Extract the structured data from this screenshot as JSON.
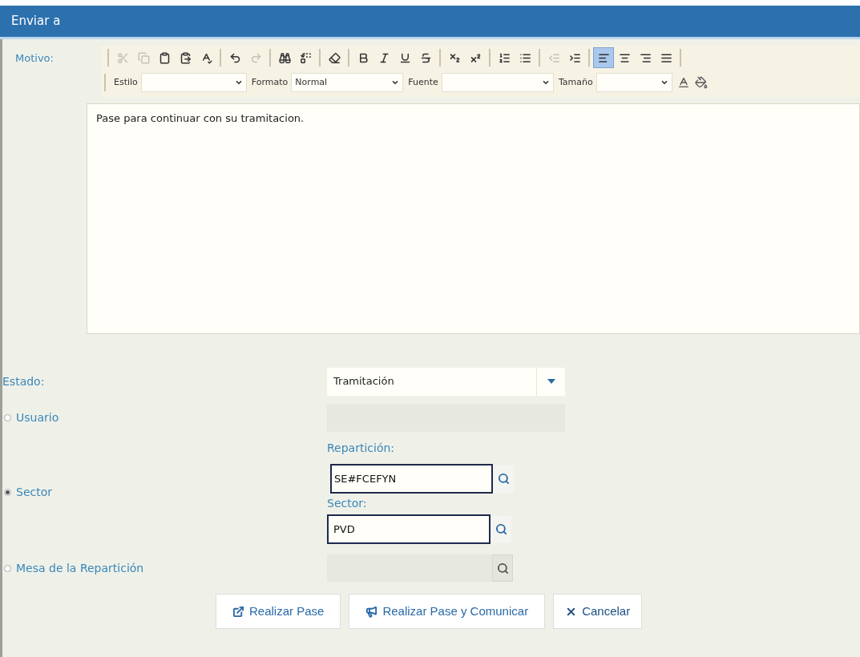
{
  "dialog": {
    "title": "Enviar a"
  },
  "motivo": {
    "label": "Motivo:",
    "text": "Pase para continuar con su tramitacion."
  },
  "toolbar": {
    "groups": [
      [
        {
          "kind": "cut",
          "disabled": true,
          "selected": false
        },
        {
          "kind": "copy",
          "disabled": true,
          "selected": false
        },
        {
          "kind": "paste",
          "disabled": false,
          "selected": false
        },
        {
          "kind": "paste-text",
          "disabled": false,
          "selected": false
        },
        {
          "kind": "spellcheck",
          "disabled": false,
          "selected": false
        }
      ],
      [
        {
          "kind": "undo",
          "disabled": false,
          "selected": false
        },
        {
          "kind": "redo",
          "disabled": true,
          "selected": false
        }
      ],
      [
        {
          "kind": "find",
          "disabled": false,
          "selected": false
        },
        {
          "kind": "replace",
          "disabled": false,
          "selected": false
        }
      ],
      [
        {
          "kind": "eraser",
          "disabled": false,
          "selected": false
        }
      ],
      [
        {
          "kind": "bold",
          "disabled": false,
          "selected": false
        },
        {
          "kind": "italic",
          "disabled": false,
          "selected": false
        },
        {
          "kind": "underline",
          "disabled": false,
          "selected": false
        },
        {
          "kind": "strike",
          "disabled": false,
          "selected": false
        }
      ],
      [
        {
          "kind": "subscript",
          "disabled": false,
          "selected": false
        },
        {
          "kind": "superscript",
          "disabled": false,
          "selected": false
        }
      ],
      [
        {
          "kind": "ordered-list",
          "disabled": false,
          "selected": false
        },
        {
          "kind": "bullet-list",
          "disabled": false,
          "selected": false
        }
      ],
      [
        {
          "kind": "outdent",
          "disabled": true,
          "selected": false
        },
        {
          "kind": "indent",
          "disabled": false,
          "selected": false
        }
      ],
      [
        {
          "kind": "align-left",
          "disabled": false,
          "selected": true
        },
        {
          "kind": "align-center",
          "disabled": false,
          "selected": false
        },
        {
          "kind": "align-right",
          "disabled": false,
          "selected": false
        },
        {
          "kind": "align-justify",
          "disabled": false,
          "selected": false
        }
      ]
    ],
    "combos": [
      {
        "label": "Estilo"
      },
      {
        "label": "Formato",
        "value": "Normal"
      },
      {
        "label": "Fuente"
      },
      {
        "label": "Tamaño"
      }
    ]
  },
  "estado": {
    "label": "Estado:",
    "value": "Tramitación"
  },
  "destinos": [
    {
      "kind": "usuario",
      "label": "Usuario",
      "selected": false,
      "disabled": true
    },
    {
      "kind": "sector",
      "label": "Sector",
      "selected": true,
      "reparticion_label": "Repartición:",
      "reparticion_value": "SE#FCEFYN",
      "sector_label": "Sector:",
      "sector_value": "PVD"
    },
    {
      "kind": "mesa",
      "label": "Mesa de la Repartición",
      "selected": false,
      "disabled": true
    }
  ],
  "buttons": [
    {
      "kind": "pase",
      "label": "Realizar Pase"
    },
    {
      "kind": "comunicar",
      "label": "Realizar Pase y Comunicar"
    },
    {
      "kind": "cancel",
      "label": "Cancelar"
    }
  ]
}
